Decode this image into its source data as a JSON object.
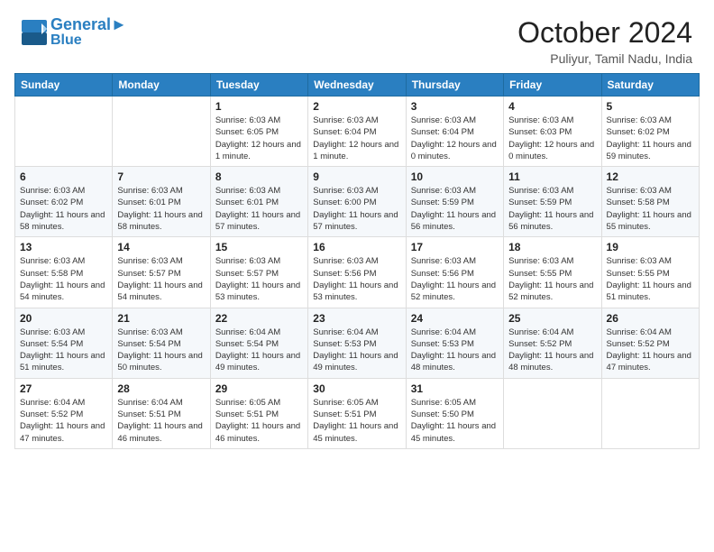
{
  "header": {
    "logo_line1": "General",
    "logo_line2": "Blue",
    "month_title": "October 2024",
    "location": "Puliyur, Tamil Nadu, India"
  },
  "weekdays": [
    "Sunday",
    "Monday",
    "Tuesday",
    "Wednesday",
    "Thursday",
    "Friday",
    "Saturday"
  ],
  "weeks": [
    [
      {
        "day": "",
        "info": ""
      },
      {
        "day": "",
        "info": ""
      },
      {
        "day": "1",
        "info": "Sunrise: 6:03 AM\nSunset: 6:05 PM\nDaylight: 12 hours and 1 minute."
      },
      {
        "day": "2",
        "info": "Sunrise: 6:03 AM\nSunset: 6:04 PM\nDaylight: 12 hours and 1 minute."
      },
      {
        "day": "3",
        "info": "Sunrise: 6:03 AM\nSunset: 6:04 PM\nDaylight: 12 hours and 0 minutes."
      },
      {
        "day": "4",
        "info": "Sunrise: 6:03 AM\nSunset: 6:03 PM\nDaylight: 12 hours and 0 minutes."
      },
      {
        "day": "5",
        "info": "Sunrise: 6:03 AM\nSunset: 6:02 PM\nDaylight: 11 hours and 59 minutes."
      }
    ],
    [
      {
        "day": "6",
        "info": "Sunrise: 6:03 AM\nSunset: 6:02 PM\nDaylight: 11 hours and 58 minutes."
      },
      {
        "day": "7",
        "info": "Sunrise: 6:03 AM\nSunset: 6:01 PM\nDaylight: 11 hours and 58 minutes."
      },
      {
        "day": "8",
        "info": "Sunrise: 6:03 AM\nSunset: 6:01 PM\nDaylight: 11 hours and 57 minutes."
      },
      {
        "day": "9",
        "info": "Sunrise: 6:03 AM\nSunset: 6:00 PM\nDaylight: 11 hours and 57 minutes."
      },
      {
        "day": "10",
        "info": "Sunrise: 6:03 AM\nSunset: 5:59 PM\nDaylight: 11 hours and 56 minutes."
      },
      {
        "day": "11",
        "info": "Sunrise: 6:03 AM\nSunset: 5:59 PM\nDaylight: 11 hours and 56 minutes."
      },
      {
        "day": "12",
        "info": "Sunrise: 6:03 AM\nSunset: 5:58 PM\nDaylight: 11 hours and 55 minutes."
      }
    ],
    [
      {
        "day": "13",
        "info": "Sunrise: 6:03 AM\nSunset: 5:58 PM\nDaylight: 11 hours and 54 minutes."
      },
      {
        "day": "14",
        "info": "Sunrise: 6:03 AM\nSunset: 5:57 PM\nDaylight: 11 hours and 54 minutes."
      },
      {
        "day": "15",
        "info": "Sunrise: 6:03 AM\nSunset: 5:57 PM\nDaylight: 11 hours and 53 minutes."
      },
      {
        "day": "16",
        "info": "Sunrise: 6:03 AM\nSunset: 5:56 PM\nDaylight: 11 hours and 53 minutes."
      },
      {
        "day": "17",
        "info": "Sunrise: 6:03 AM\nSunset: 5:56 PM\nDaylight: 11 hours and 52 minutes."
      },
      {
        "day": "18",
        "info": "Sunrise: 6:03 AM\nSunset: 5:55 PM\nDaylight: 11 hours and 52 minutes."
      },
      {
        "day": "19",
        "info": "Sunrise: 6:03 AM\nSunset: 5:55 PM\nDaylight: 11 hours and 51 minutes."
      }
    ],
    [
      {
        "day": "20",
        "info": "Sunrise: 6:03 AM\nSunset: 5:54 PM\nDaylight: 11 hours and 51 minutes."
      },
      {
        "day": "21",
        "info": "Sunrise: 6:03 AM\nSunset: 5:54 PM\nDaylight: 11 hours and 50 minutes."
      },
      {
        "day": "22",
        "info": "Sunrise: 6:04 AM\nSunset: 5:54 PM\nDaylight: 11 hours and 49 minutes."
      },
      {
        "day": "23",
        "info": "Sunrise: 6:04 AM\nSunset: 5:53 PM\nDaylight: 11 hours and 49 minutes."
      },
      {
        "day": "24",
        "info": "Sunrise: 6:04 AM\nSunset: 5:53 PM\nDaylight: 11 hours and 48 minutes."
      },
      {
        "day": "25",
        "info": "Sunrise: 6:04 AM\nSunset: 5:52 PM\nDaylight: 11 hours and 48 minutes."
      },
      {
        "day": "26",
        "info": "Sunrise: 6:04 AM\nSunset: 5:52 PM\nDaylight: 11 hours and 47 minutes."
      }
    ],
    [
      {
        "day": "27",
        "info": "Sunrise: 6:04 AM\nSunset: 5:52 PM\nDaylight: 11 hours and 47 minutes."
      },
      {
        "day": "28",
        "info": "Sunrise: 6:04 AM\nSunset: 5:51 PM\nDaylight: 11 hours and 46 minutes."
      },
      {
        "day": "29",
        "info": "Sunrise: 6:05 AM\nSunset: 5:51 PM\nDaylight: 11 hours and 46 minutes."
      },
      {
        "day": "30",
        "info": "Sunrise: 6:05 AM\nSunset: 5:51 PM\nDaylight: 11 hours and 45 minutes."
      },
      {
        "day": "31",
        "info": "Sunrise: 6:05 AM\nSunset: 5:50 PM\nDaylight: 11 hours and 45 minutes."
      },
      {
        "day": "",
        "info": ""
      },
      {
        "day": "",
        "info": ""
      }
    ]
  ]
}
